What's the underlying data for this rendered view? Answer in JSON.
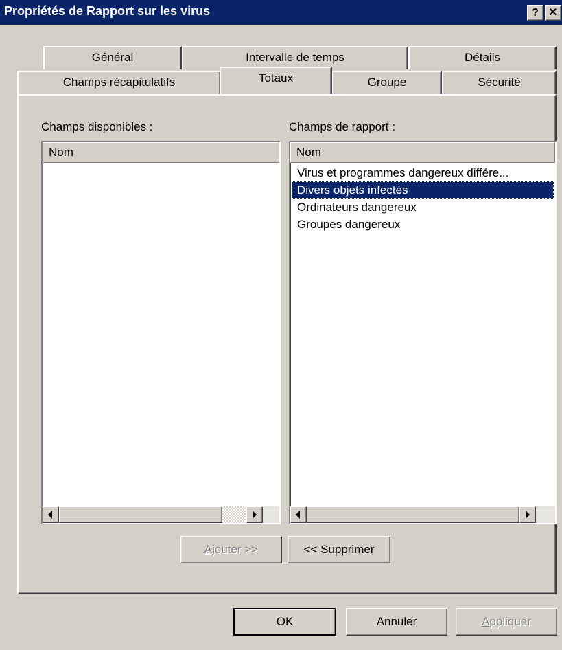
{
  "window": {
    "title": "Propriétés de Rapport sur les virus",
    "help_label": "?",
    "close_label": "✕"
  },
  "tabs": {
    "row1": [
      "Général",
      "Intervalle de temps",
      "Détails"
    ],
    "row2": [
      "Champs récapitulatifs",
      "Totaux",
      "Groupe",
      "Sécurité"
    ],
    "selected": "Totaux"
  },
  "available": {
    "label": "Champs disponibles :",
    "column": "Nom",
    "items": []
  },
  "report": {
    "label": "Champs de rapport :",
    "column": "Nom",
    "items": [
      "Virus et programmes dangereux différe...",
      "Divers objets infectés",
      "Ordinateurs dangereux",
      "Groupes dangereux"
    ],
    "selected_index": 1
  },
  "actions": {
    "add": {
      "mnemonic": "A",
      "rest": "jouter >>"
    },
    "remove": {
      "mnemonic": "<",
      "rest": "< Supprimer"
    }
  },
  "footer": {
    "ok": "OK",
    "cancel": "Annuler",
    "apply": {
      "mnemonic": "A",
      "rest": "ppliquer"
    }
  },
  "colors": {
    "titlebar": "#0a246a",
    "face": "#d4d0c8",
    "selection": "#0a246a"
  }
}
